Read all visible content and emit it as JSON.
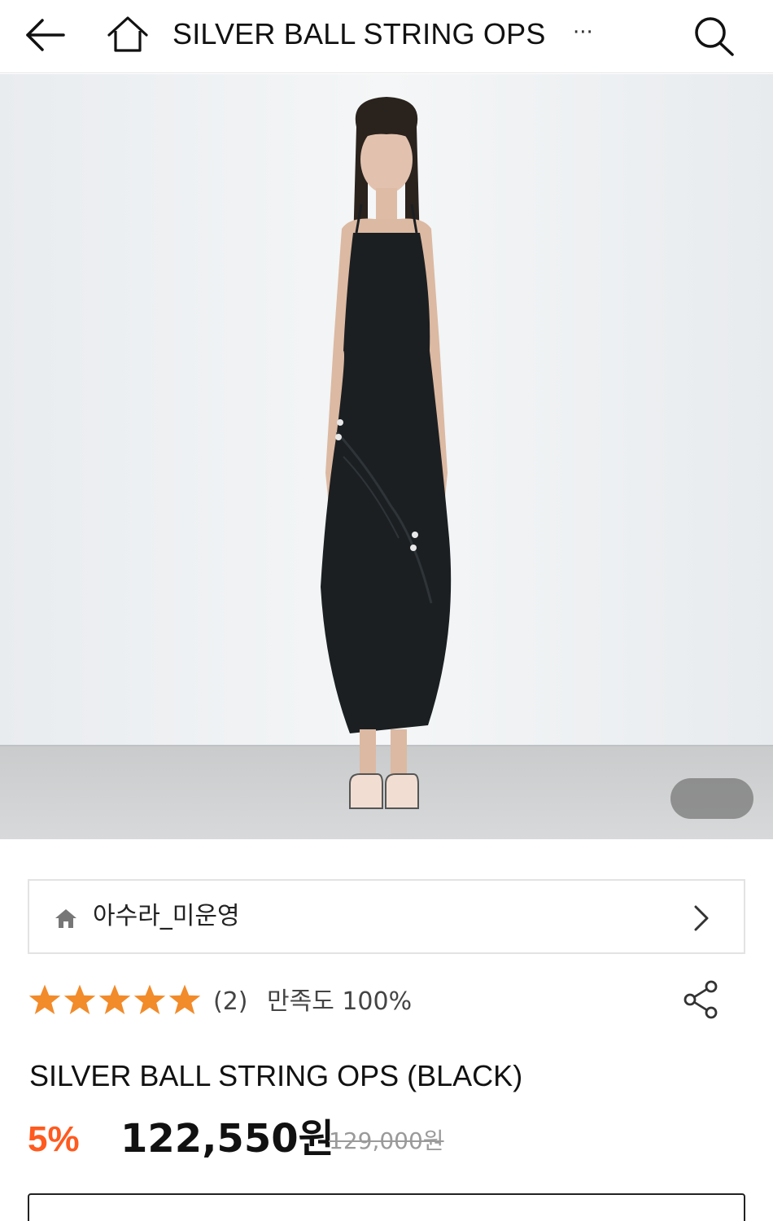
{
  "header": {
    "title": "SILVER BALL STRING OPS",
    "more": "···",
    "icons": [
      "back-arrow-icon",
      "home-icon",
      "search-icon"
    ]
  },
  "store": {
    "name": "아수라_미운영",
    "icon": "home-icon"
  },
  "rating": {
    "stars": 5,
    "count": "(2)",
    "satisfaction": "만족도 100%",
    "star_color": "#f28b2a"
  },
  "product": {
    "name": "SILVER BALL STRING OPS (BLACK)",
    "discount": "5%",
    "sale_price": "122,550원",
    "original_price": "129,000원"
  },
  "colors": {
    "accent": "#ff5a1f",
    "text": "#111111",
    "muted": "#9a9a9a"
  }
}
